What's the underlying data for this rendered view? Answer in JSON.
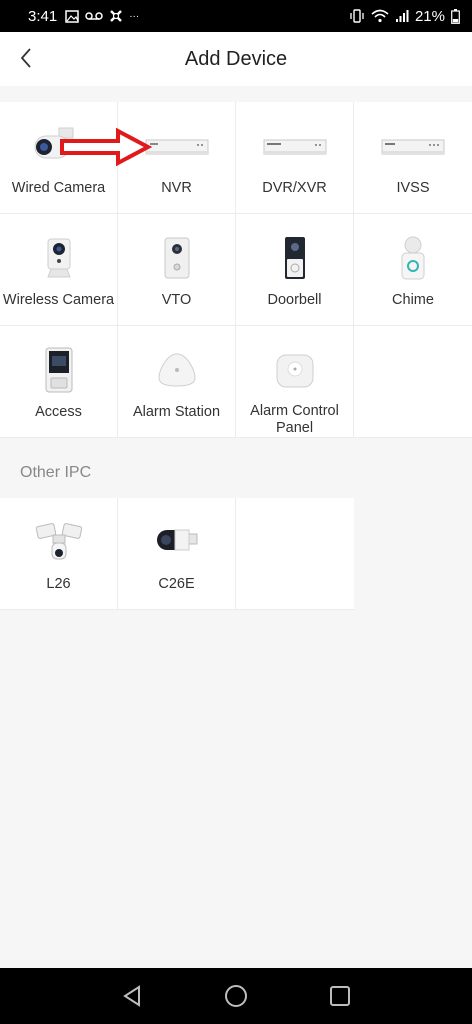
{
  "status_bar": {
    "time": "3:41",
    "icons": [
      "image-icon",
      "voicemail-icon",
      "virus-shield-icon",
      "more-dots-icon"
    ],
    "more_text": "···",
    "battery_percent": "21%"
  },
  "header": {
    "title": "Add Device"
  },
  "devices": [
    {
      "label": "Wired Camera",
      "icon": "wired-camera-icon"
    },
    {
      "label": "NVR",
      "icon": "nvr-icon"
    },
    {
      "label": "DVR/XVR",
      "icon": "dvr-xvr-icon"
    },
    {
      "label": "IVSS",
      "icon": "ivss-icon"
    },
    {
      "label": "Wireless Camera",
      "icon": "wireless-camera-icon"
    },
    {
      "label": "VTO",
      "icon": "vto-icon"
    },
    {
      "label": "Doorbell",
      "icon": "doorbell-icon"
    },
    {
      "label": "Chime",
      "icon": "chime-icon"
    },
    {
      "label": "Access",
      "icon": "access-icon"
    },
    {
      "label": "Alarm Station",
      "icon": "alarm-station-icon"
    },
    {
      "label": "Alarm Control Panel",
      "icon": "alarm-control-panel-icon"
    }
  ],
  "other_section": {
    "title": "Other IPC",
    "devices": [
      {
        "label": "L26",
        "icon": "floodlight-camera-icon"
      },
      {
        "label": "C26E",
        "icon": "bullet-camera-icon"
      }
    ]
  },
  "annotation": {
    "arrow_color": "#e0191b"
  },
  "navbar": {
    "icons": [
      "back-triangle-icon",
      "home-circle-icon",
      "recents-square-icon"
    ]
  }
}
